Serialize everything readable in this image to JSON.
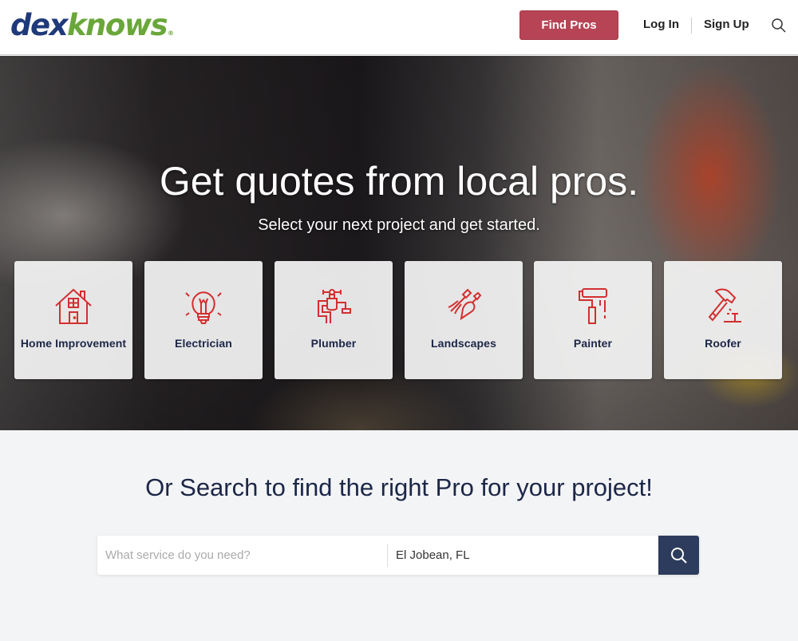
{
  "brand": {
    "logo_part1": "dex",
    "logo_part2": "knows",
    "logo_mark": "®",
    "primary_color": "#1f3a7a",
    "secondary_color": "#6aa73a"
  },
  "header": {
    "find_pros_label": "Find Pros",
    "find_pros_color": "#b74455",
    "login_label": "Log In",
    "signup_label": "Sign Up",
    "search_icon": "search-icon"
  },
  "hero": {
    "title": "Get quotes from local pros.",
    "subtitle": "Select your next project and get started.",
    "categories": [
      {
        "label": "Home Improvement",
        "icon": "house-icon"
      },
      {
        "label": "Electrician",
        "icon": "lightbulb-icon"
      },
      {
        "label": "Plumber",
        "icon": "faucet-icon"
      },
      {
        "label": "Landscapes",
        "icon": "garden-tools-icon"
      },
      {
        "label": "Painter",
        "icon": "paint-roller-icon"
      },
      {
        "label": "Roofer",
        "icon": "hammer-icon"
      }
    ],
    "icon_color": "#d32f2f"
  },
  "search": {
    "heading": "Or Search to find the right Pro for your project!",
    "service_placeholder": "What service do you need?",
    "service_value": "",
    "location_value": "El Jobean, FL",
    "button_icon": "search-icon",
    "button_color": "#2d3c5c"
  }
}
